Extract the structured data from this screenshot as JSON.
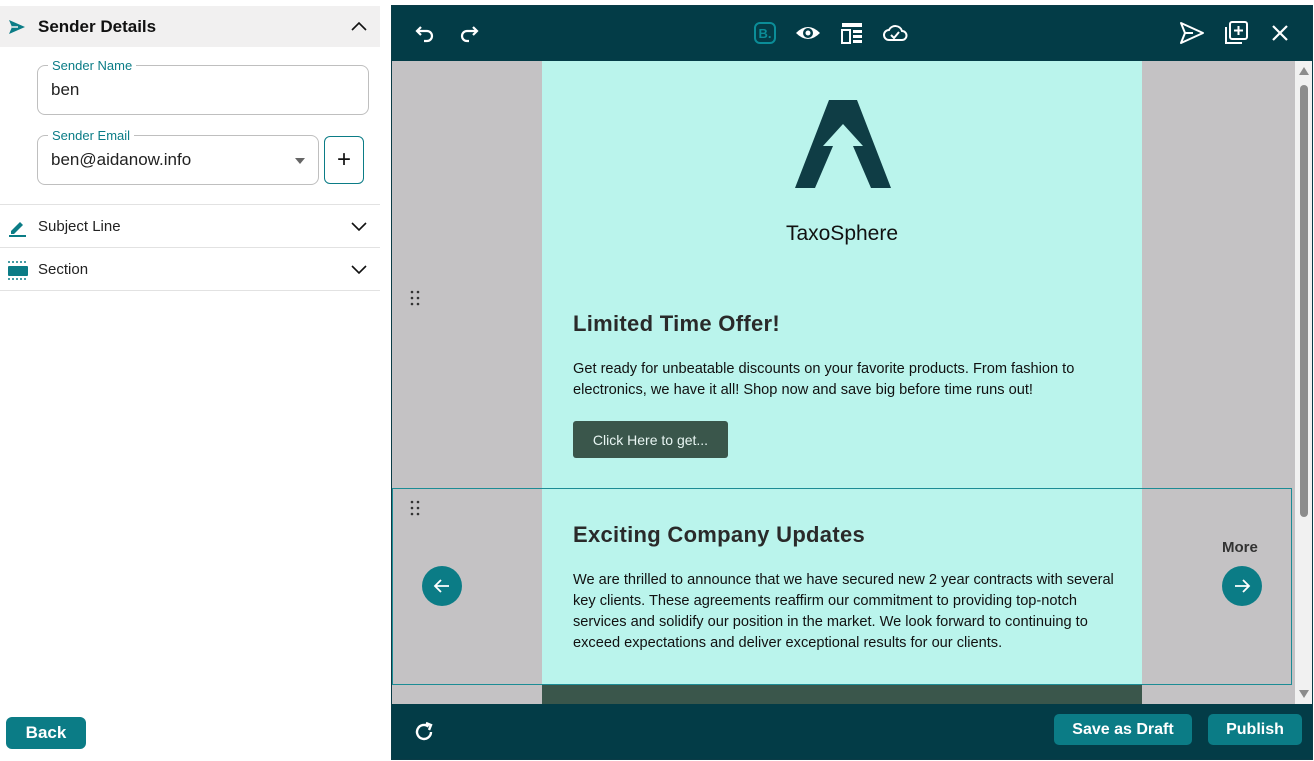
{
  "sender_details": {
    "title": "Sender Details",
    "sender_name": {
      "label": "Sender Name",
      "value": "ben"
    },
    "sender_email": {
      "label": "Sender Email",
      "value": "ben@aidanow.info"
    },
    "add_label": "+"
  },
  "sections": [
    {
      "label": "Subject Line"
    },
    {
      "label": "Section"
    }
  ],
  "back_label": "Back",
  "email": {
    "brand": "TaxoSphere",
    "offer_title": "Limited Time Offer!",
    "offer_text": "Get ready for unbeatable discounts on your favorite products. From fashion to electronics, we have it all! Shop now and save big before time runs out!",
    "cta_label": "Click Here to get...",
    "updates_title": "Exciting Company Updates",
    "updates_text": "We are thrilled to announce that we have secured new 2 year contracts with several key clients. These agreements reaffirm our commitment to providing top-notch services and solidify our position in the market. We look forward to continuing to exceed expectations and deliver exceptional results for our clients."
  },
  "more_label": "More",
  "save_draft_label": "Save as Draft",
  "publish_label": "Publish",
  "icons": {
    "toolbar_left": [
      "undo-icon",
      "redo-icon"
    ],
    "toolbar_center": [
      "bootstrap-icon",
      "preview-eye-icon",
      "layout-icon",
      "cloud-check-icon"
    ],
    "toolbar_right": [
      "send-icon",
      "add-block-icon",
      "close-icon"
    ]
  },
  "colors": {
    "accent": "#0b7c86",
    "toolbar": "#033c47",
    "email_bg": "#baf4ec",
    "button_dark": "#3a564b",
    "canvas_bg": "#c4c2c4"
  }
}
